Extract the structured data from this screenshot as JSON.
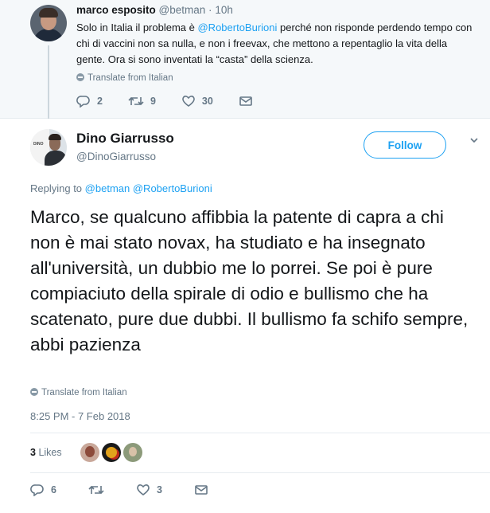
{
  "parent_tweet": {
    "author_name": "marco esposito",
    "author_handle": "@betman",
    "time": "10h",
    "text_before": "Solo in Italia il problema è ",
    "mention": "@RobertoBurioni",
    "text_after": " perché non risponde perdendo tempo con chi di vaccini non sa nulla, e non i freevax, che mettono a repentaglio la vita della gente. Ora si sono inventati la “casta” della scienza.",
    "translate_label": "Translate from Italian",
    "reply_count": "2",
    "retweet_count": "9",
    "like_count": "30"
  },
  "main_tweet": {
    "author_name": "Dino Giarrusso",
    "author_handle": "@DinoGiarrusso",
    "follow_label": "Follow",
    "replying_label": "Replying to",
    "replying_to_1": "@betman",
    "replying_to_2": "@RobertoBurioni",
    "text": "Marco, se qualcuno affibbia la patente di capra a chi non è mai stato novax, ha studiato e ha insegnato all'università, un dubbio me lo porrei. Se poi è pure compiaciuto della spirale di odio e bullismo che ha scatenato, pure due dubbi. Il bullismo fa schifo sempre, abbi pazienza",
    "translate_label": "Translate from Italian",
    "timestamp": "8:25 PM - 7 Feb 2018",
    "likes_count": "3",
    "likes_label": "Likes",
    "reply_count": "6",
    "like_count": "3"
  },
  "colors": {
    "accent": "#1da1f2",
    "muted": "#657786",
    "text": "#14171a",
    "parent_bg": "#f5f8fa"
  },
  "icons": [
    "reply-icon",
    "retweet-icon",
    "like-icon",
    "dm-icon",
    "globe-icon",
    "chevron-down-icon"
  ]
}
